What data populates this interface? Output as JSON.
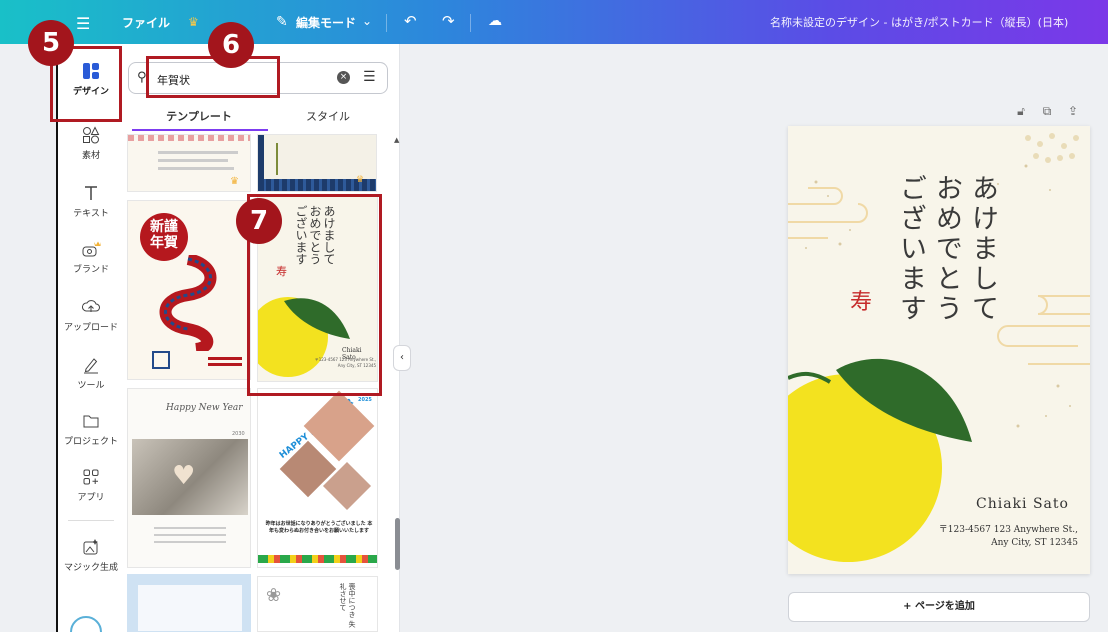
{
  "topbar": {
    "file_label": "ファイル",
    "edit_mode_label": "編集モード",
    "doc_title": "名称未設定のデザイン - はがき/ポストカード（縦長）(日本)"
  },
  "rail": {
    "items": [
      {
        "label": "デザイン",
        "icon": "design-icon"
      },
      {
        "label": "素材",
        "icon": "elements-icon"
      },
      {
        "label": "テキスト",
        "icon": "text-icon"
      },
      {
        "label": "ブランド",
        "icon": "brand-icon"
      },
      {
        "label": "アップロード",
        "icon": "upload-icon"
      },
      {
        "label": "ツール",
        "icon": "tools-icon"
      },
      {
        "label": "プロジェクト",
        "icon": "folder-icon"
      },
      {
        "label": "アプリ",
        "icon": "apps-icon"
      },
      {
        "label": "マジック生成",
        "icon": "magic-icon"
      }
    ]
  },
  "search": {
    "value": "年賀状"
  },
  "tabs": {
    "templates": "テンプレート",
    "styles": "スタイル"
  },
  "thumbs": {
    "kinga_line1": "新謹",
    "kinga_line2": "年賀",
    "selected_lines": [
      "あけまして",
      "おめでとう",
      "ございます"
    ],
    "selected_kotobuki": "寿",
    "selected_name": "Chiaki Sato",
    "selected_addr": "〒123-4567 123 Anywhere St., Any City, ST 12345",
    "wedding_title": "Happy New Year",
    "wedding_year": "2030",
    "photo_title": "HAPPY NEW YEAR",
    "photo_year": "2025",
    "photo_msg": "昨年はお世話になりありがとうございました 本年も変わらぬお付き合いをお願いいたします",
    "mourning_text": "喪中につき 失礼させて"
  },
  "card": {
    "greeting_lines": [
      "あけまして",
      "おめでとう",
      "ございます"
    ],
    "kotobuki": "寿",
    "name": "Chiaki Sato",
    "addr_line1": "〒123-4567 123 Anywhere St.,",
    "addr_line2": "Any City, ST 12345"
  },
  "add_page_label": "+ ページを追加",
  "badges": {
    "b5": "5",
    "b6": "6",
    "b7": "7"
  },
  "colors": {
    "accent_red": "#a3151c",
    "yuzu_yellow": "#f3e21f",
    "leaf_green": "#2f6b2a"
  }
}
